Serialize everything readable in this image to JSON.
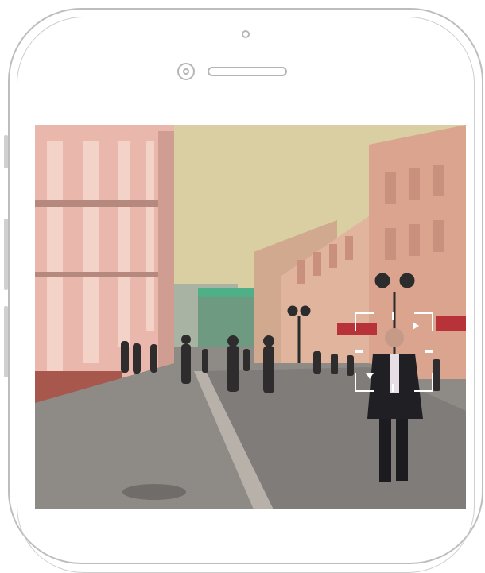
{
  "device": {
    "type": "smartphone",
    "icons": [
      "front-camera-icon",
      "proximity-sensor-icon",
      "earpiece-speaker-icon"
    ]
  },
  "screen": {
    "content": "camera-view",
    "detection_overlay": {
      "icons": [
        "triangle-right-icon",
        "triangle-down-icon"
      ]
    }
  },
  "colors": {
    "sky": "#d9cfa3",
    "pavement": "#8e8a86",
    "building_left": "#e9b7ab",
    "building_right": "#d9a48d",
    "frame_outline": "#bdbdbd",
    "detection_box": "#ffffff"
  }
}
